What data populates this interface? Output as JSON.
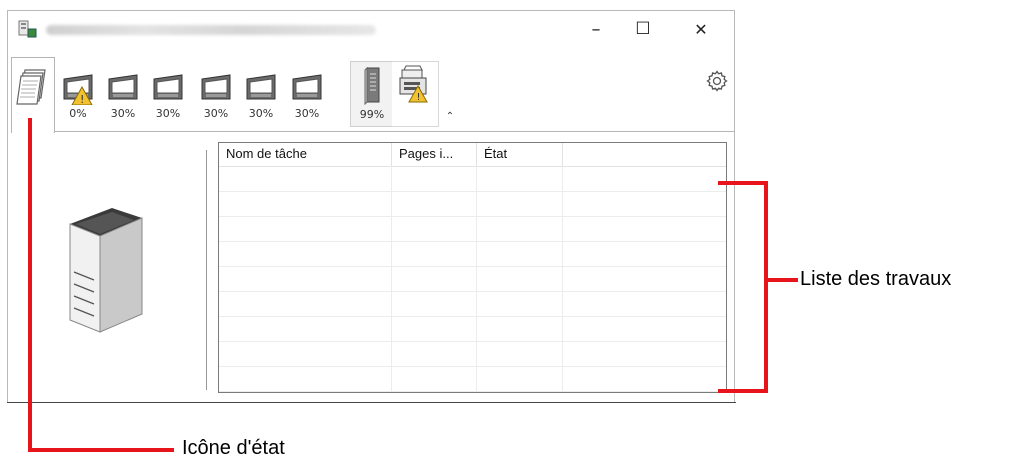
{
  "window": {
    "controls": {
      "minimize": "–",
      "maximize": "☐",
      "close": "✕"
    }
  },
  "toolbar": {
    "trays": [
      {
        "label": "0%",
        "warning": true
      },
      {
        "label": "30%",
        "warning": false
      },
      {
        "label": "30%",
        "warning": false
      },
      {
        "label": "30%",
        "warning": false
      },
      {
        "label": "30%",
        "warning": false
      },
      {
        "label": "30%",
        "warning": false
      }
    ],
    "toner_label": "99%",
    "collapse_glyph": "⌃"
  },
  "job_list": {
    "columns": [
      "Nom de tâche",
      "Pages i...",
      "État"
    ],
    "rows": 9
  },
  "annotations": {
    "job_list_label": "Liste des travaux",
    "status_icon_label": "Icône d'état"
  },
  "colors": {
    "annotation_red": "#e8141c",
    "warning_yellow": "#f2c230"
  }
}
